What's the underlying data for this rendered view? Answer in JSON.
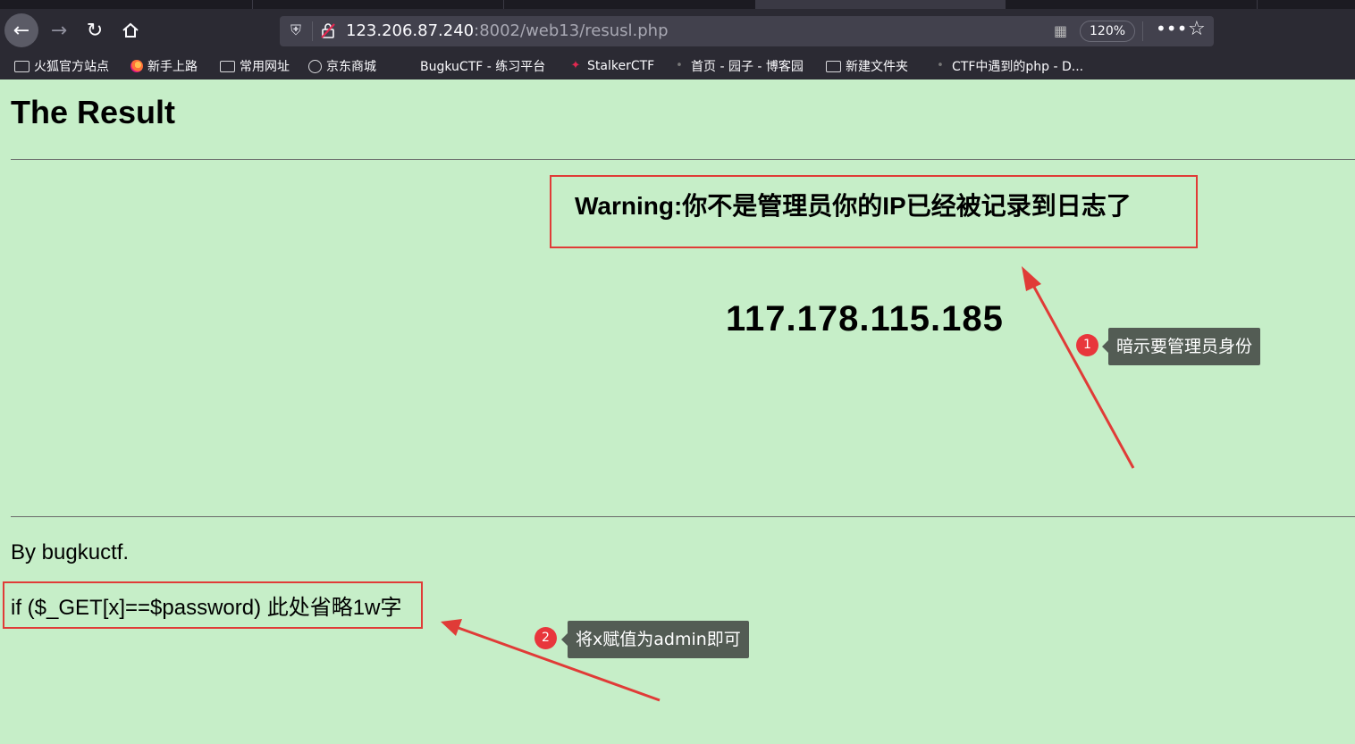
{
  "browser": {
    "url_host": "123.206.87.240",
    "url_path": ":8002/web13/resusl.php",
    "zoom": "120%",
    "bookmarks": [
      {
        "label": "火狐官方站点",
        "icon": "folder-icon"
      },
      {
        "label": "新手上路",
        "icon": "firefox-icon"
      },
      {
        "label": "常用网址",
        "icon": "folder-icon"
      },
      {
        "label": "京东商城",
        "icon": "globe-icon"
      },
      {
        "label": "BugkuCTF - 练习平台",
        "icon": "none"
      },
      {
        "label": "StalkerCTF",
        "icon": "stalker-icon"
      },
      {
        "label": "首页 - 园子 - 博客园",
        "icon": "blog-icon"
      },
      {
        "label": "新建文件夹",
        "icon": "folder-icon"
      },
      {
        "label": "CTF中遇到的php - D...",
        "icon": "page-icon"
      }
    ]
  },
  "page": {
    "title": "The Result",
    "warning": "Warning:你不是管理员你的IP已经被记录到日志了",
    "ip": "117.178.115.185",
    "by": "By bugkuctf.",
    "code": "if ($_GET[x]==$password) 此处省略1w字"
  },
  "annotations": [
    {
      "number": "1",
      "text": "暗示要管理员身份"
    },
    {
      "number": "2",
      "text": "将x赋值为admin即可"
    }
  ],
  "colors": {
    "page_bg": "#c6eec8",
    "highlight": "#e03b37",
    "tooltip_bg": "#535c54",
    "chrome_bg": "#2b2a33"
  }
}
